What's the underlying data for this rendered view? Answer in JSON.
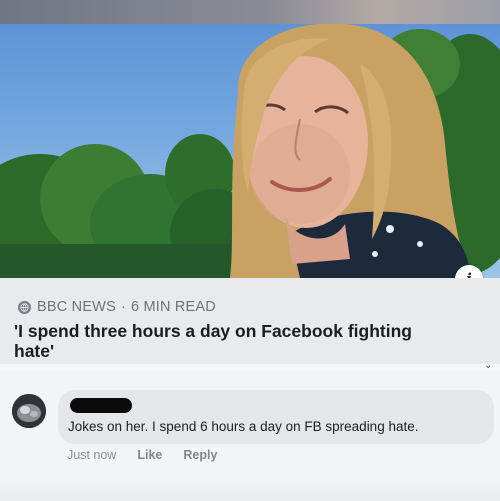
{
  "post": {
    "image_subject": "woman-portrait-photo",
    "info_label": "i",
    "source_name": "BBC NEWS",
    "read_time": "6 MIN READ",
    "separator": "·",
    "headline": "'I spend three hours a day on Facebook fighting hate'"
  },
  "comment": {
    "author_name_redacted": true,
    "text": "Jokes on her. I spend 6 hours a day on FB spreading hate.",
    "timestamp": "Just now",
    "like_label": "Like",
    "reply_label": "Reply"
  },
  "colors": {
    "card_background": "#e8eaee",
    "bubble_background": "#e4e6ea",
    "headline_text": "#1b1d21",
    "meta_text": "#6f7279"
  },
  "icons": {
    "source": "globe-icon",
    "info": "info-icon",
    "avatar": "avatar-icon",
    "more": "chevron-down-icon"
  }
}
